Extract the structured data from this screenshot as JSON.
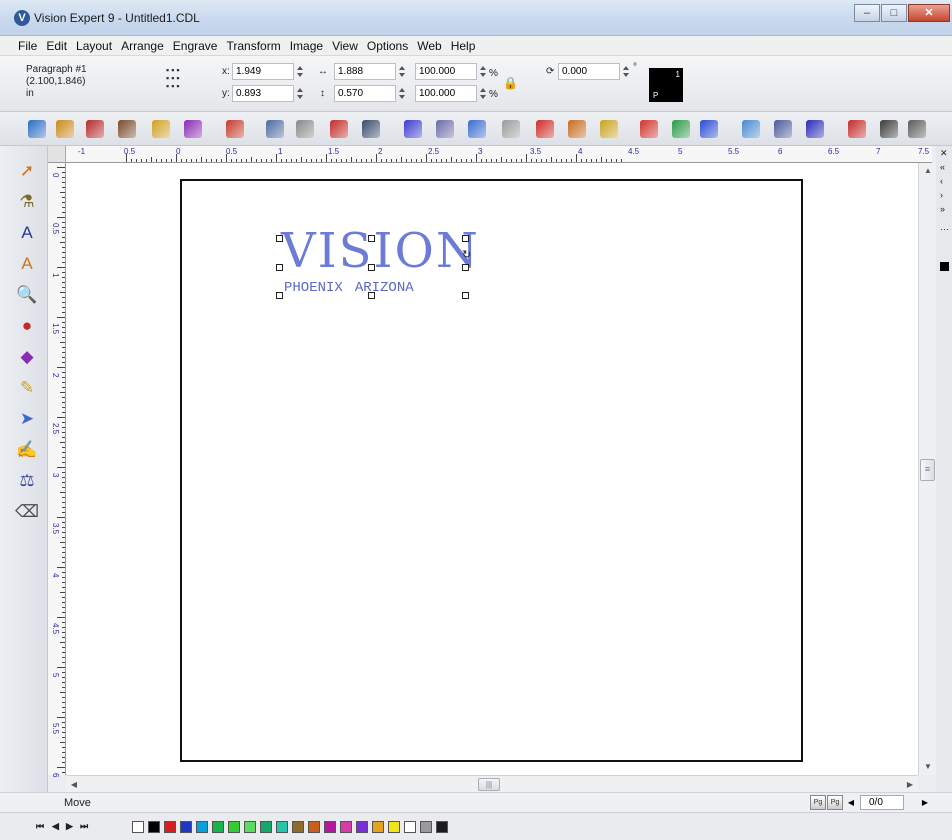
{
  "window": {
    "title": "Vision Expert 9  - Untitled1.CDL",
    "app_icon": "vision-logo-icon",
    "buttons": [
      "minimize",
      "maximize",
      "close"
    ]
  },
  "menu": [
    "File",
    "Edit",
    "Layout",
    "Arrange",
    "Engrave",
    "Transform",
    "Image",
    "View",
    "Options",
    "Web",
    "Help"
  ],
  "property_bar": {
    "object_name": "Paragraph #1",
    "object_coords": "(2.100,1.846)",
    "units": "in",
    "x_label": "x:",
    "x_value": "1.949",
    "y_label": "y:",
    "y_value": "0.893",
    "width_value": "1.888",
    "height_value": "0.570",
    "scale_x": "100.000",
    "scale_y": "100.000",
    "percent_symbol": "%",
    "rotation": "0.000",
    "degree_symbol": "°",
    "swatch_label_top": "1",
    "swatch_label_bottom": "P"
  },
  "toolbar": {
    "icons": [
      "open-icon",
      "save-icon",
      "print-icon",
      "import-icon",
      "scan-icon",
      "engrave-icon",
      "plot-icon",
      "undo-icon",
      "redo-icon",
      "node-icon",
      "copy-icon",
      "layer-icon",
      "image-icon",
      "panel-icon",
      "weld-icon",
      "break-icon",
      "fill-icon",
      "library-icon",
      "color-icon",
      "group-icon",
      "circle-icon",
      "align-icon",
      "text-icon",
      "border-icon",
      "kill-icon",
      "trace-icon",
      "tool-icon",
      "extra-icon"
    ]
  },
  "ruler": {
    "h_labels": [
      "-1",
      "0.5",
      "0",
      "0.5",
      "1",
      "1.5",
      "2",
      "2.5",
      "3",
      "3.5",
      "4",
      "4.5",
      "5",
      "5.5",
      "6",
      "6.5",
      "7",
      "7.5"
    ],
    "v_labels": [
      "0",
      "0.5",
      "1",
      "1.5",
      "2",
      "2.5",
      "3",
      "3.5",
      "4",
      "4.5",
      "5",
      "5.5",
      "6"
    ]
  },
  "toolbox": [
    "select-tool-icon",
    "engrave-tool-icon",
    "text-tool-icon",
    "artistic-text-icon",
    "zoom-tool-icon",
    "shape-tool-icon",
    "fill-tool-icon",
    "pencil-tool-icon",
    "node-edit-icon",
    "brush-tool-icon",
    "measure-tool-icon",
    "eraser-tool-icon"
  ],
  "canvas": {
    "main_text": "VISION",
    "sub_text_left": "PHOENIX",
    "sub_text_right": "ARIZONA"
  },
  "status": {
    "message": "Move",
    "page_counter": "0/0"
  },
  "palette": {
    "nav": [
      "⏮",
      "◀",
      "▶",
      "⏭"
    ],
    "colors": [
      "#ffffff",
      "#000000",
      "#d81e1e",
      "#1d39c4",
      "#0aa0d8",
      "#19b34a",
      "#33cc33",
      "#5fd95f",
      "#17a66b",
      "#27c6a8",
      "#8f6a2c",
      "#c95f1d",
      "#b5179e",
      "#d63ca8",
      "#7b2fd8",
      "#e6a21c",
      "#f2e417",
      "#ffffff",
      "#9a9a9a",
      "#1b1b1b"
    ]
  }
}
